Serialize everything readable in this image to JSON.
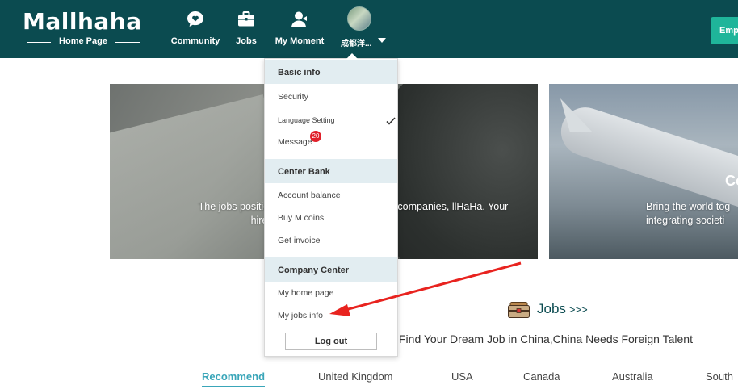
{
  "header": {
    "logo_text": "Mallhaha",
    "logo_subtitle": "Home Page",
    "nav": [
      {
        "label": "Community",
        "icon": "chat-heart-icon"
      },
      {
        "label": "Jobs",
        "icon": "briefcase-icon"
      },
      {
        "label": "My Moment",
        "icon": "user-icon"
      }
    ],
    "user_name": "成都洋...",
    "emp_button_label": "Emp"
  },
  "dropdown": {
    "sections": [
      {
        "title": "Basic info",
        "items": [
          "Security",
          "Language Setting",
          "Message"
        ]
      },
      {
        "title": "Center Bank",
        "items": [
          "Account balance",
          "Buy M coins",
          "Get invoice"
        ]
      },
      {
        "title": "Company Center",
        "items": [
          "My home page",
          "My jobs info"
        ]
      }
    ],
    "message_badge": "20",
    "logout_label": "Log out"
  },
  "banners": [
    {
      "text_left": "The jobs positio licensed to hire",
      "text_right": "d companies, llHaHa. Your"
    },
    {
      "title": "Co",
      "text": "Bring the world tog integrating societi"
    }
  ],
  "jobs": {
    "title": "Jobs",
    "arrows": ">>>",
    "subtitle": "Find Your Dream Job in China,China Needs Foreign Talent",
    "tabs": [
      "Recommend",
      "United Kingdom",
      "USA",
      "Canada",
      "Australia",
      "South"
    ],
    "active_tab": "Recommend"
  },
  "colors": {
    "header_bg": "#0b4b50",
    "accent": "#3aa6b9",
    "emp_button": "#1fb59a",
    "badge": "#e0202a",
    "annotation_arrow": "#e8231f"
  }
}
